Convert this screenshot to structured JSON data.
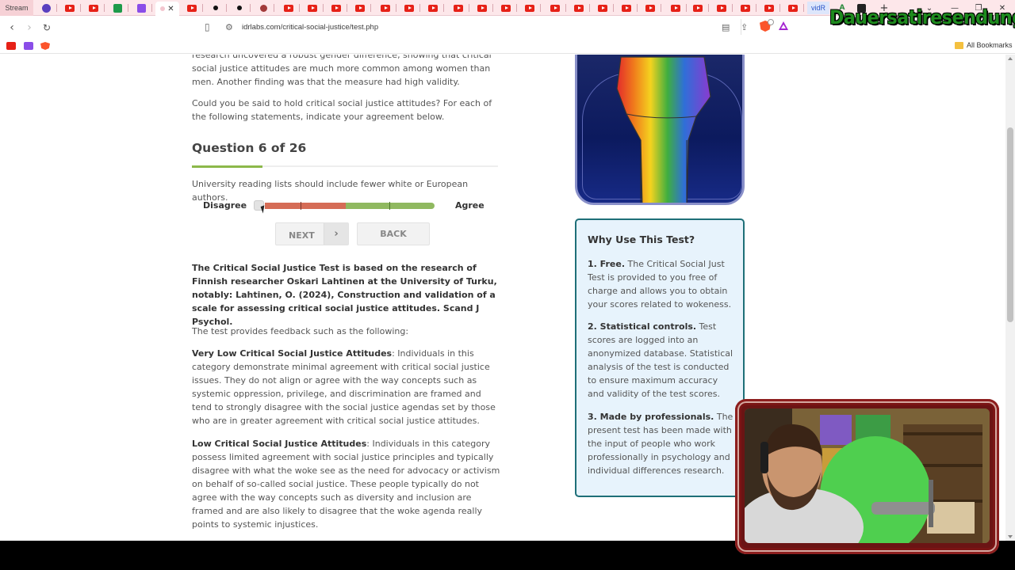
{
  "browser": {
    "first_tab_label": "Stream",
    "vidr_tab_label": "vidR",
    "url": "idrlabs.com/critical-social-justice/test.php",
    "all_bookmarks_label": "All Bookmarks"
  },
  "overlay": {
    "channel_name": "Dauersatiresendung"
  },
  "main": {
    "intro_fragment": "research uncovered a robust gender difference, showing that critical social justice attitudes are much more common among women than men. Another finding was that the measure had high validity.",
    "intro_question": "Could you be said to hold critical social justice attitudes? For each of the following statements, indicate your agreement below.",
    "question_title": "Question 6 of 26",
    "statement": "University reading lists should include fewer white or European authors.",
    "scale_left": "Disagree",
    "scale_right": "Agree",
    "next_label": "NEXT",
    "back_label": "BACK",
    "research_note": "The Critical Social Justice Test is based on the research of Finnish researcher Oskari Lahtinen at the University of Turku, notably: Lahtinen, O. (2024), Construction and validation of a scale for assessing critical social justice attitudes. Scand J Psychol.",
    "feedback_intro": "The test provides feedback such as the following:",
    "very_low_heading": "Very Low Critical Social Justice Attitudes",
    "very_low_text": ": Individuals in this category demonstrate minimal agreement with critical social justice issues. They do not align or agree with the way concepts such as systemic oppression, privilege, and discrimination are framed and tend to strongly disagree with the social justice agendas set by those who are in greater agreement with critical social justice attitudes.",
    "low_heading": "Low Critical Social Justice Attitudes",
    "low_text": ": Individuals in this category possess limited agreement with social justice principles and typically disagree with what the woke see as the need for advocacy or activism on behalf of so-called social justice. These people typically do not agree with the way concepts such as diversity and inclusion are framed and are also likely to disagree that the woke agenda really points to systemic injustices."
  },
  "sidebar": {
    "title": "Why Use This Test?",
    "items": [
      {
        "heading": "1. Free.",
        "text": " The Critical Social Just Test is provided to you free of charge and allows you to obtain your scores related to wokeness."
      },
      {
        "heading": "2. Statistical controls.",
        "text": " Test scores are logged into an anonymized database. Statistical analysis of the test is conducted to ensure maximum accuracy and validity of the test scores."
      },
      {
        "heading": "3. Made by professionals.",
        "text": " The present test has been made with the input of people who work professionally in psychology and individual differences research."
      }
    ]
  },
  "colors": {
    "accent_green": "#8cb84a",
    "slider_red": "#d56c56",
    "slider_green": "#90b960",
    "sidebar_border": "#1e6f78",
    "sidebar_bg": "#e7f3fc"
  }
}
